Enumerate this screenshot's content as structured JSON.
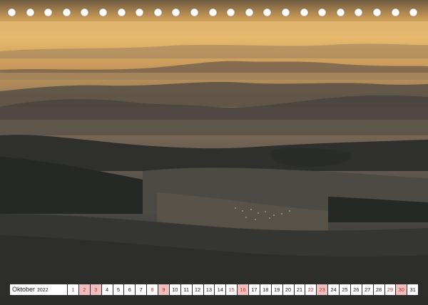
{
  "calendar": {
    "month": "Oktober",
    "year": "2022",
    "days": [
      {
        "n": "1",
        "t": "sat"
      },
      {
        "n": "2",
        "t": "sun"
      },
      {
        "n": "3",
        "t": "hol"
      },
      {
        "n": "4",
        "t": "wk"
      },
      {
        "n": "5",
        "t": "wk"
      },
      {
        "n": "6",
        "t": "wk"
      },
      {
        "n": "7",
        "t": "wk"
      },
      {
        "n": "8",
        "t": "sat"
      },
      {
        "n": "9",
        "t": "sun"
      },
      {
        "n": "10",
        "t": "wk"
      },
      {
        "n": "11",
        "t": "wk"
      },
      {
        "n": "12",
        "t": "wk"
      },
      {
        "n": "13",
        "t": "wk"
      },
      {
        "n": "14",
        "t": "wk"
      },
      {
        "n": "15",
        "t": "sat"
      },
      {
        "n": "16",
        "t": "sun"
      },
      {
        "n": "17",
        "t": "wk"
      },
      {
        "n": "18",
        "t": "wk"
      },
      {
        "n": "19",
        "t": "wk"
      },
      {
        "n": "20",
        "t": "wk"
      },
      {
        "n": "21",
        "t": "wk"
      },
      {
        "n": "22",
        "t": "sat"
      },
      {
        "n": "23",
        "t": "sun"
      },
      {
        "n": "24",
        "t": "wk"
      },
      {
        "n": "25",
        "t": "wk"
      },
      {
        "n": "26",
        "t": "wk"
      },
      {
        "n": "27",
        "t": "wk"
      },
      {
        "n": "28",
        "t": "wk"
      },
      {
        "n": "29",
        "t": "sat"
      },
      {
        "n": "30",
        "t": "sun"
      },
      {
        "n": "31",
        "t": "wk"
      }
    ]
  },
  "binding_rings": 23
}
